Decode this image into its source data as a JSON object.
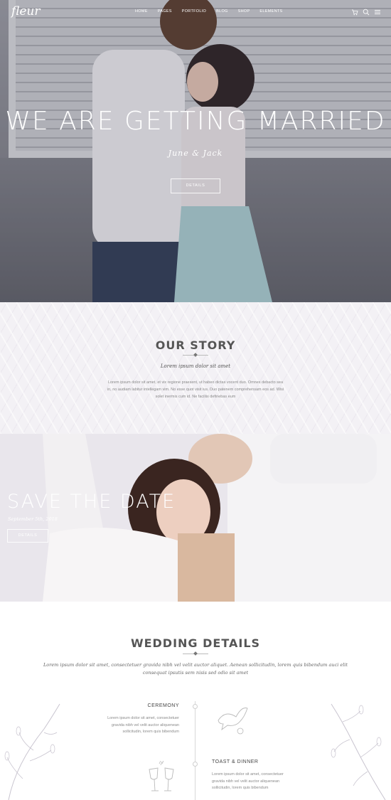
{
  "nav": {
    "logo": "fleur",
    "menu": [
      "HOME",
      "PAGES",
      "PORTFOLIO",
      "BLOG",
      "SHOP",
      "ELEMENTS"
    ],
    "cart_count": "0"
  },
  "hero": {
    "title": "WE ARE GETTING MARRIED",
    "names": "June & Jack",
    "button": "DETAILS"
  },
  "story": {
    "title": "OUR STORY",
    "subtitle": "Lorem ipsum dolor sit amet",
    "body": "Lorem ipsum dolor sit amet, et vix regione praesent, ut habeo dictas vocent duo. Omnes debacto sea in, no audiam labitur intellegam vim. No esse quot visit ius. Duo patenem comprehensam eos ad. Wisi solet inermis cum id. Ne facilisi definebas eum"
  },
  "save": {
    "title": "SAVE THE DATE",
    "date": "September 5th, 2018",
    "button": "DETAILS"
  },
  "details": {
    "title": "WEDDING DETAILS",
    "subtitle": "Lorem ipsum dolor sit amet, consectetuer gravida nibh vel velit auctor aliquet. Aenean sollicitudin, lorem quis bibendum auci elit consequat ipsutis sem nisis sed odio sit amet",
    "events": [
      {
        "title": "CEREMONY",
        "body": "Lorem ipsum dolor sit amet, consectetuer gravida nibh vel velit auctor aliquenean sollicitudin, lorem quis bibendum"
      },
      {
        "title": "TOAST & DINNER",
        "body": "Lorem ipsum dolor sit amet, consectetuer gravida nibh vel velit auctor aliquenean sollicitudin, lorem quis bibendum"
      }
    ]
  },
  "colors": {
    "accent_text": "#555555",
    "story_bg": "#f3f1f5",
    "line": "#d8d8d8"
  }
}
